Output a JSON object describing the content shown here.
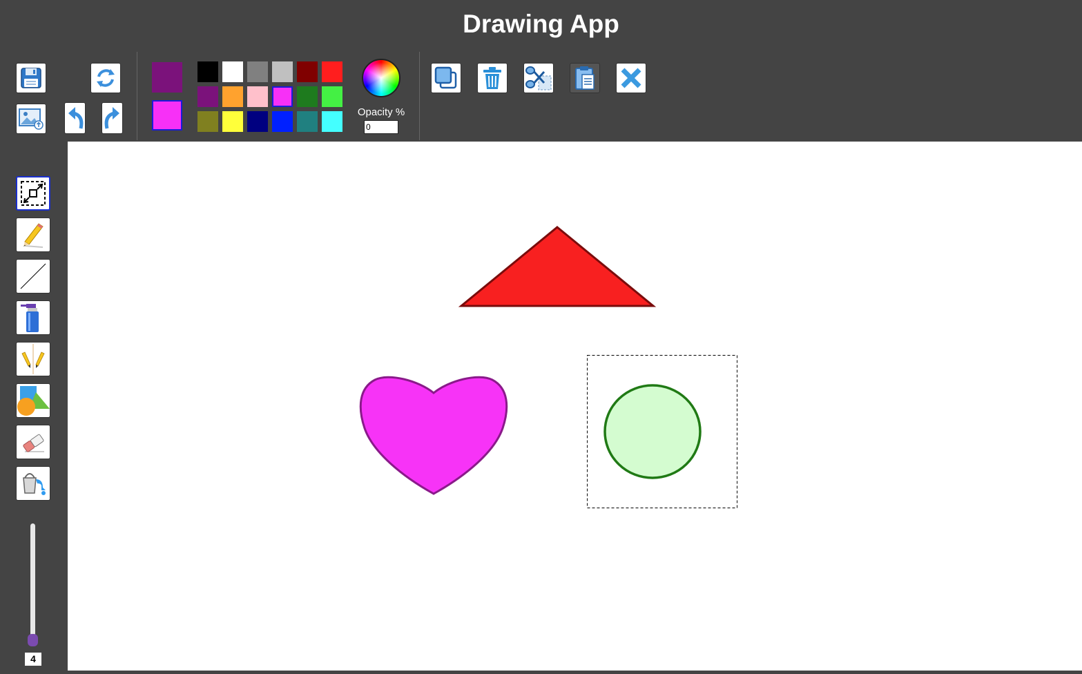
{
  "app": {
    "title": "Drawing App"
  },
  "toolbar": {
    "save_tooltip": "",
    "buttons": [
      "save",
      "refresh",
      "upload-image",
      "undo",
      "redo",
      "duplicate",
      "delete",
      "cut",
      "paste",
      "close"
    ]
  },
  "colors": {
    "primary": "#7b127b",
    "secondary": "#f730f7",
    "palette": [
      [
        "#000000",
        "#ffffff",
        "#808080",
        "#c0c0c0",
        "#800000",
        "#ff1e1e"
      ],
      [
        "#7b127b",
        "#ffa22e",
        "#ffc0cb",
        "#f730f7",
        "#1e7b1e",
        "#44f044"
      ],
      [
        "#808020",
        "#ffff3a",
        "#000080",
        "#0020ff",
        "#208080",
        "#44ffff"
      ]
    ],
    "selected_palette_color": "#f730f7"
  },
  "opacity": {
    "label": "Opacity %",
    "value": "0"
  },
  "tools": [
    {
      "name": "select",
      "icon": "select-icon",
      "active": true
    },
    {
      "name": "pencil",
      "icon": "pencil-icon",
      "active": false
    },
    {
      "name": "line",
      "icon": "line-icon",
      "active": false
    },
    {
      "name": "spray",
      "icon": "spray-icon",
      "active": false
    },
    {
      "name": "mirror-draw",
      "icon": "mirror-pencil-icon",
      "active": false
    },
    {
      "name": "shapes",
      "icon": "shapes-icon",
      "active": false
    },
    {
      "name": "eraser",
      "icon": "eraser-icon",
      "active": false
    },
    {
      "name": "fill",
      "icon": "paint-bucket-icon",
      "active": false
    }
  ],
  "brush_size": {
    "value": "4",
    "level": 0.05
  },
  "canvas": {
    "shapes": [
      {
        "type": "triangle",
        "fill": "#f82020",
        "stroke": "#7a0c0c"
      },
      {
        "type": "heart",
        "fill": "#f733f7",
        "stroke": "#8a1a8a"
      },
      {
        "type": "circle",
        "fill": "#d4fcd0",
        "stroke": "#207a15",
        "selected": true
      }
    ]
  }
}
